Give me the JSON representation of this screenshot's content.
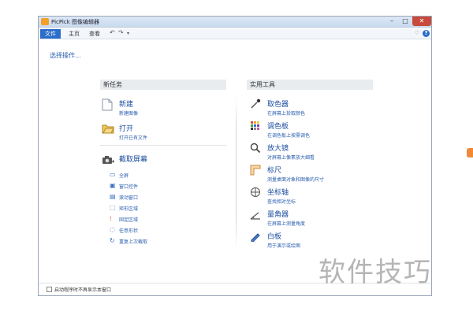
{
  "window": {
    "title": "PicPick 图像编辑器",
    "controls": {
      "minimize": "–",
      "maximize": "□",
      "close": "✕"
    }
  },
  "ribbon": {
    "tabs": [
      {
        "label": "文件",
        "active": true
      },
      {
        "label": "主页"
      },
      {
        "label": "查看"
      }
    ],
    "undo": "↶",
    "redo": "↷",
    "quick_access_dropdown": "▾",
    "heart": "♡",
    "help": "?"
  },
  "main": {
    "choose_action": "选择操作..."
  },
  "new_tasks": {
    "header": "新任务",
    "items": [
      {
        "title": "新建",
        "subtitle": "新建图像",
        "icon": "new-file-icon"
      },
      {
        "title": "打开",
        "subtitle": "打开已有文件",
        "icon": "open-folder-icon"
      },
      {
        "title": "截取屏幕",
        "subtitle": "",
        "icon": "camera-icon"
      }
    ],
    "capture_options": [
      {
        "label": "全屏",
        "icon": "fullscreen-icon"
      },
      {
        "label": "窗口控件",
        "icon": "window-control-icon"
      },
      {
        "label": "滚动窗口",
        "icon": "scroll-window-icon"
      },
      {
        "label": "矩形区域",
        "icon": "rect-region-icon"
      },
      {
        "label": "固定区域",
        "icon": "fixed-region-icon"
      },
      {
        "label": "任意形状",
        "icon": "freehand-icon"
      },
      {
        "label": "重复上次截取",
        "icon": "repeat-icon"
      }
    ]
  },
  "tools": {
    "header": "实用工具",
    "items": [
      {
        "title": "取色器",
        "subtitle": "在屏幕上拾取颜色",
        "icon": "eyedropper-icon"
      },
      {
        "title": "调色板",
        "subtitle": "在调色板上按需调色",
        "icon": "palette-icon"
      },
      {
        "title": "放大镜",
        "subtitle": "对屏幕上像素放大细看",
        "icon": "magnifier-icon"
      },
      {
        "title": "标尺",
        "subtitle": "测量桌面对象和图像的尺寸",
        "icon": "ruler-icon"
      },
      {
        "title": "坐标轴",
        "subtitle": "查找相对坐标",
        "icon": "crosshair-icon"
      },
      {
        "title": "量角器",
        "subtitle": "在屏幕上测量角度",
        "icon": "protractor-icon"
      },
      {
        "title": "白板",
        "subtitle": "用于演示或绘图",
        "icon": "pen-icon"
      }
    ]
  },
  "status": {
    "startup_checkbox_label": "启动程序时不再显示本窗口",
    "checked": false
  },
  "watermark": "软件技巧",
  "colors": {
    "accent": "#2b6dc9",
    "link": "#2b5fb0",
    "title_link": "#1d4fa0",
    "close": "#c84a3c"
  }
}
